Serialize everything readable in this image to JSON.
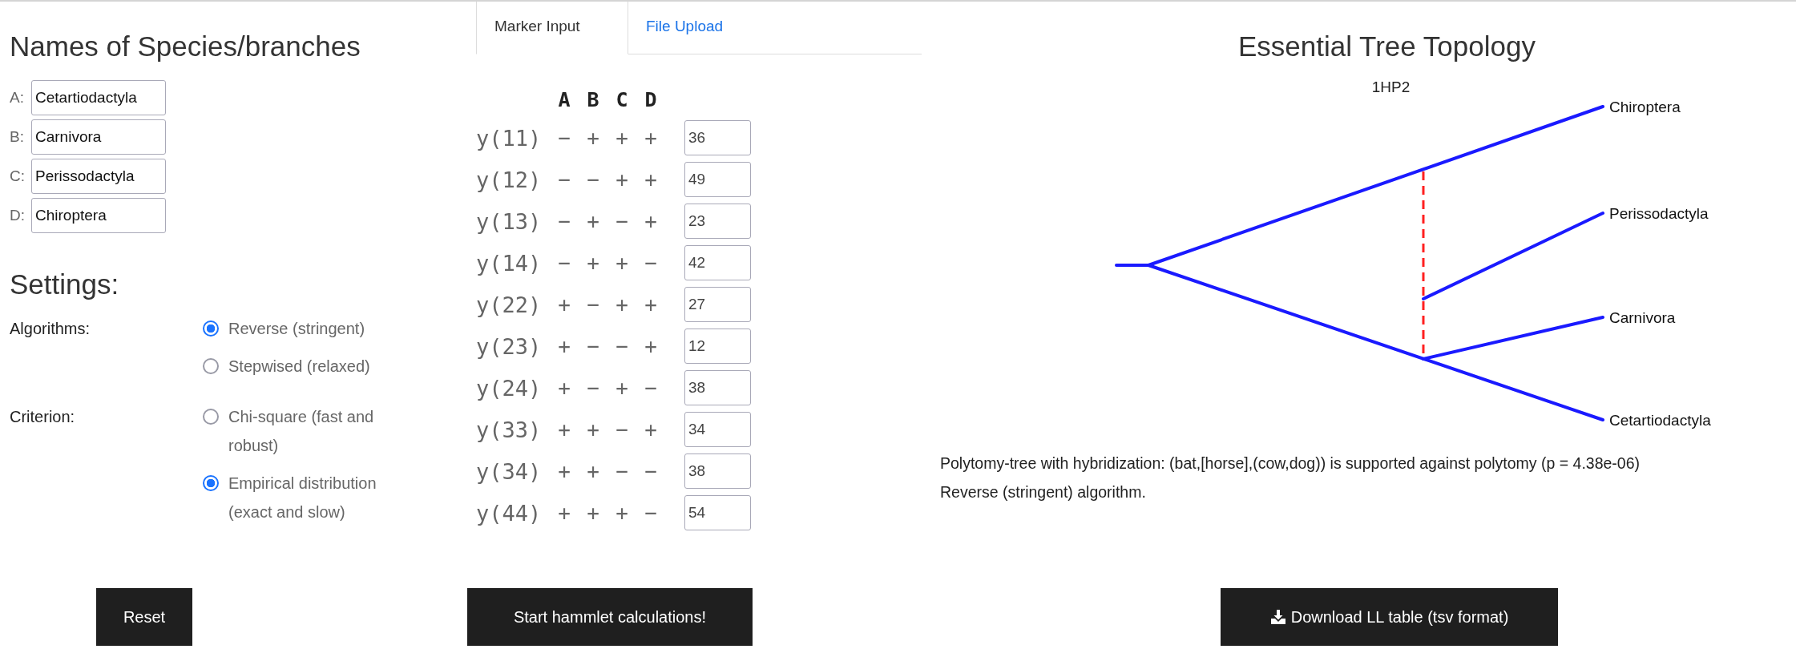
{
  "names": {
    "title": "Names of Species/branches",
    "fields": [
      {
        "label": "A:",
        "value": "Cetartiodactyla"
      },
      {
        "label": "B:",
        "value": "Carnivora"
      },
      {
        "label": "C:",
        "value": "Perissodactyla"
      },
      {
        "label": "D:",
        "value": "Chiroptera"
      }
    ]
  },
  "settings": {
    "title": "Settings:",
    "groups": [
      {
        "label": "Algorithms:",
        "options": [
          {
            "label": "Reverse (stringent)",
            "selected": true
          },
          {
            "label": "Stepwised (relaxed)",
            "selected": false
          }
        ]
      },
      {
        "label": "Criterion:",
        "options": [
          {
            "label": "Chi-square (fast and robust)",
            "selected": false
          },
          {
            "label": "Empirical distribution (exact and slow)",
            "selected": true
          }
        ]
      }
    ]
  },
  "reset_button": "Reset",
  "tabs": [
    {
      "label": "Marker Input",
      "selected": true
    },
    {
      "label": "File Upload",
      "selected": false
    }
  ],
  "markers": {
    "columns": [
      "A",
      "B",
      "C",
      "D"
    ],
    "rows": [
      {
        "label": "y(11)",
        "signs": [
          "−",
          "+",
          "+",
          "+"
        ],
        "value": "36"
      },
      {
        "label": "y(12)",
        "signs": [
          "−",
          "−",
          "+",
          "+"
        ],
        "value": "49"
      },
      {
        "label": "y(13)",
        "signs": [
          "−",
          "+",
          "−",
          "+"
        ],
        "value": "23"
      },
      {
        "label": "y(14)",
        "signs": [
          "−",
          "+",
          "+",
          "−"
        ],
        "value": "42"
      },
      {
        "label": "y(22)",
        "signs": [
          "+",
          "−",
          "+",
          "+"
        ],
        "value": "27"
      },
      {
        "label": "y(23)",
        "signs": [
          "+",
          "−",
          "−",
          "+"
        ],
        "value": "12"
      },
      {
        "label": "y(24)",
        "signs": [
          "+",
          "−",
          "+",
          "−"
        ],
        "value": "38"
      },
      {
        "label": "y(33)",
        "signs": [
          "+",
          "+",
          "−",
          "+"
        ],
        "value": "34"
      },
      {
        "label": "y(34)",
        "signs": [
          "+",
          "+",
          "−",
          "−"
        ],
        "value": "38"
      },
      {
        "label": "y(44)",
        "signs": [
          "+",
          "+",
          "+",
          "−"
        ],
        "value": "54"
      }
    ]
  },
  "start_button": "Start hammlet calculations!",
  "topology": {
    "title": "Essential Tree Topology",
    "subtitle": "1HP2",
    "tips": [
      "Chiroptera",
      "Perissodactyla",
      "Carnivora",
      "Cetartiodactyla"
    ],
    "result_lines": [
      "Polytomy-tree with hybridization: (bat,[horse],(cow,dog)) is supported against polytomy (p = 4.38e-06)",
      "Reverse (stringent) algorithm."
    ]
  },
  "download_button": "Download LL table (tsv format)"
}
